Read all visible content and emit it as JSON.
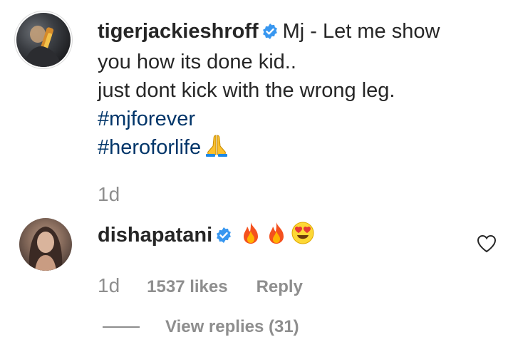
{
  "comments": [
    {
      "username": "tigerjackieshroff",
      "verified": true,
      "lines": [
        "Mj - Let me show",
        "you how its done kid..",
        "just dont kick with the wrong leg."
      ],
      "hashtags": [
        "#mjforever",
        "#heroforlife"
      ],
      "emoji": "folded-hands",
      "time": "1d"
    },
    {
      "username": "dishapatani",
      "verified": true,
      "emojis": [
        "fire",
        "fire",
        "heart-eyes"
      ],
      "time": "1d",
      "likes": "1537 likes",
      "reply_label": "Reply",
      "view_replies": "View replies (31)"
    }
  ],
  "colors": {
    "text": "#262626",
    "muted": "#8e8e8e",
    "hashtag": "#003569",
    "verified": "#3897f0"
  }
}
